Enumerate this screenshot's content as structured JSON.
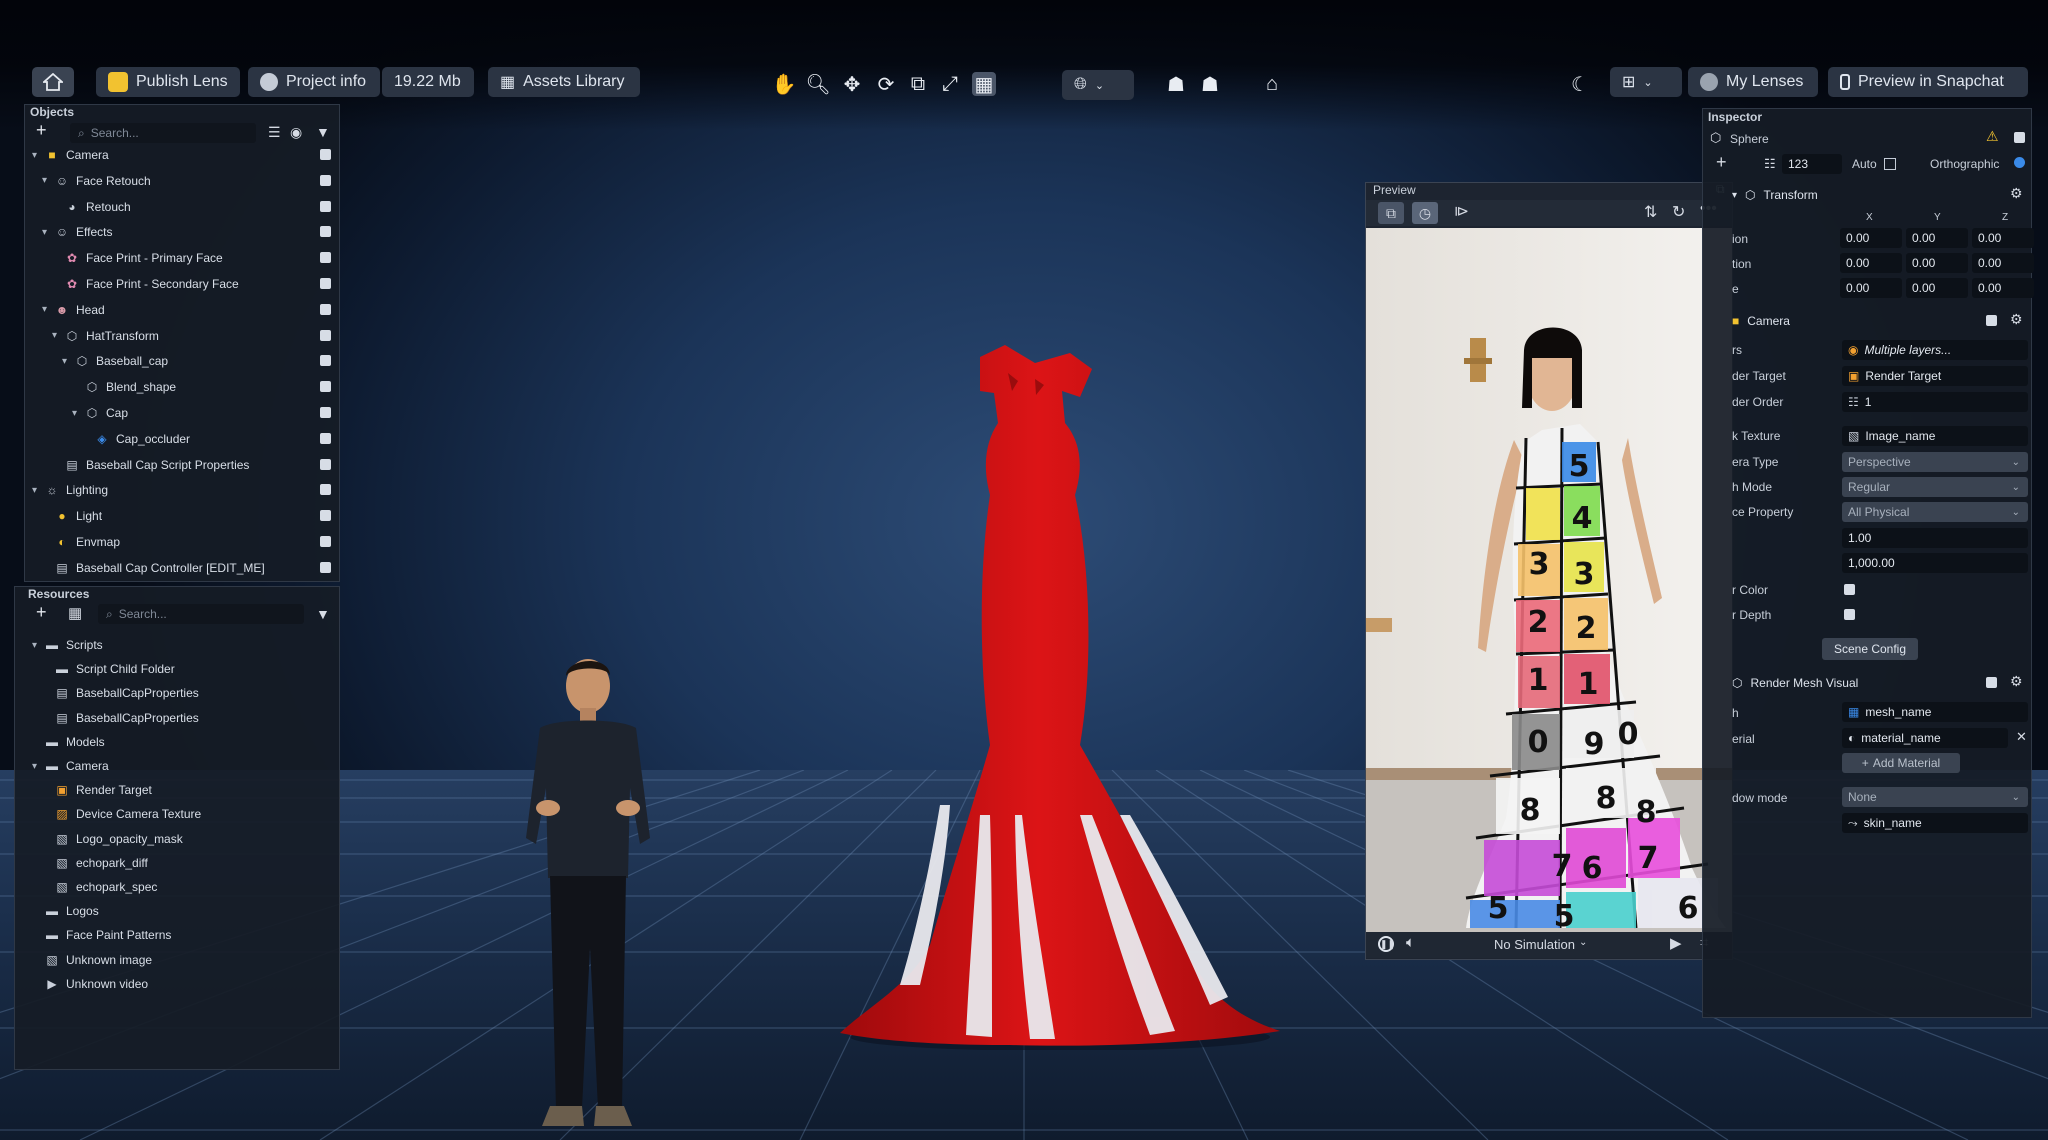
{
  "toolbar": {
    "publish_lens": "Publish Lens",
    "project_info": "Project info",
    "project_size": "19.22 Mb",
    "assets_library": "Assets Library",
    "my_lenses": "My Lenses",
    "preview_in_snapchat": "Preview in Snapchat"
  },
  "objects_panel": {
    "title": "Objects",
    "search_placeholder": "Search...",
    "items": [
      {
        "label": "Camera",
        "depth": 0,
        "icon": "camera-icon"
      },
      {
        "label": "Face Retouch",
        "depth": 1,
        "icon": "face-icon"
      },
      {
        "label": "Retouch",
        "depth": 2,
        "icon": "retouch-icon"
      },
      {
        "label": "Effects",
        "depth": 1,
        "icon": "face-icon"
      },
      {
        "label": "Face Print - Primary Face",
        "depth": 2,
        "icon": "face-print-icon"
      },
      {
        "label": "Face Print - Secondary Face",
        "depth": 2,
        "icon": "face-print-icon"
      },
      {
        "label": "Head",
        "depth": 1,
        "icon": "head-icon"
      },
      {
        "label": "HatTransform",
        "depth": 2,
        "icon": "transform-icon"
      },
      {
        "label": "Baseball_cap",
        "depth": 3,
        "icon": "transform-icon"
      },
      {
        "label": "Blend_shape",
        "depth": 4,
        "icon": "transform-icon"
      },
      {
        "label": "Cap",
        "depth": 4,
        "icon": "transform-icon"
      },
      {
        "label": "Cap_occluder",
        "depth": 5,
        "icon": "mesh-icon"
      },
      {
        "label": "Baseball Cap Script Properties",
        "depth": 2,
        "icon": "script-icon"
      },
      {
        "label": "Lighting",
        "depth": 0,
        "icon": "lighting-icon"
      },
      {
        "label": "Light",
        "depth": 1,
        "icon": "light-bulb-icon"
      },
      {
        "label": "Envmap",
        "depth": 1,
        "icon": "envmap-icon"
      },
      {
        "label": "Baseball Cap Controller [EDIT_ME]",
        "depth": 1,
        "icon": "script-icon"
      }
    ]
  },
  "resources_panel": {
    "title": "Resources",
    "search_placeholder": "Search...",
    "items": [
      {
        "label": "Scripts",
        "depth": 0,
        "icon": "folder-icon"
      },
      {
        "label": "Script Child Folder",
        "depth": 1,
        "icon": "folder-icon"
      },
      {
        "label": "BaseballCapProperties",
        "depth": 1,
        "icon": "script-icon"
      },
      {
        "label": "BaseballCapProperties",
        "depth": 1,
        "icon": "script-icon"
      },
      {
        "label": "Models",
        "depth": 0,
        "icon": "folder-icon"
      },
      {
        "label": "Camera",
        "depth": 0,
        "icon": "folder-icon"
      },
      {
        "label": "Render Target",
        "depth": 1,
        "icon": "render-target-icon"
      },
      {
        "label": "Device Camera Texture",
        "depth": 1,
        "icon": "texture-icon"
      },
      {
        "label": "Logo_opacity_mask",
        "depth": 1,
        "icon": "image-icon"
      },
      {
        "label": "echopark_diff",
        "depth": 1,
        "icon": "image-icon"
      },
      {
        "label": "echopark_spec",
        "depth": 1,
        "icon": "image-icon"
      },
      {
        "label": "Logos",
        "depth": 0,
        "icon": "folder-icon"
      },
      {
        "label": "Face Paint Patterns",
        "depth": 0,
        "icon": "folder-icon"
      },
      {
        "label": "Unknown image",
        "depth": 0,
        "icon": "image-icon"
      },
      {
        "label": "Unknown video",
        "depth": 0,
        "icon": "video-icon"
      }
    ]
  },
  "preview": {
    "title": "Preview",
    "simulation": "No Simulation",
    "dress_numbers": [
      "5",
      "4",
      "3",
      "2",
      "3",
      "1",
      "2",
      "0",
      "1",
      "9",
      "8",
      "0",
      "8",
      "7",
      "8",
      "6",
      "7",
      "5",
      "6",
      "5"
    ]
  },
  "inspector": {
    "title": "Inspector",
    "object_name": "Sphere",
    "layer_value": "123",
    "auto_label": "Auto",
    "orthographic_label": "Orthographic",
    "transform": {
      "title": "Transform",
      "axis_labels": [
        "X",
        "Y",
        "Z"
      ],
      "row_labels": [
        "ion",
        "tion",
        "e"
      ],
      "values": [
        [
          "0.00",
          "0.00",
          "0.00"
        ],
        [
          "0.00",
          "0.00",
          "0.00"
        ],
        [
          "0.00",
          "0.00",
          "0.00"
        ]
      ]
    },
    "camera": {
      "title": "Camera",
      "rows": [
        {
          "label": "rs",
          "value": "Multiple layers..."
        },
        {
          "label": "der Target",
          "value": "Render Target"
        },
        {
          "label": "der Order",
          "value": "1"
        },
        {
          "label": "k Texture",
          "value": "Image_name"
        },
        {
          "label": "era Type",
          "value": "Perspective"
        },
        {
          "label": "h Mode",
          "value": "Regular"
        },
        {
          "label": "ce Property",
          "value": "All Physical"
        },
        {
          "label": "",
          "value": "1.00"
        },
        {
          "label": "",
          "value": "1,000.00"
        },
        {
          "label": "r Color",
          "value": ""
        },
        {
          "label": "r Depth",
          "value": ""
        }
      ],
      "scene_config": "Scene Config"
    },
    "render_mesh": {
      "title": "Render Mesh Visual",
      "mesh_label": "h",
      "mesh_value": "mesh_name",
      "material_label": "erial",
      "material_value": "material_name",
      "add_material": "Add Material",
      "shadow_label": "dow mode",
      "shadow_value": "None",
      "skin_value": "skin_name"
    }
  },
  "colors": {
    "accent_yellow": "#f2c230",
    "dress_red": "#d40f12",
    "panel_bg": "#161c26"
  }
}
